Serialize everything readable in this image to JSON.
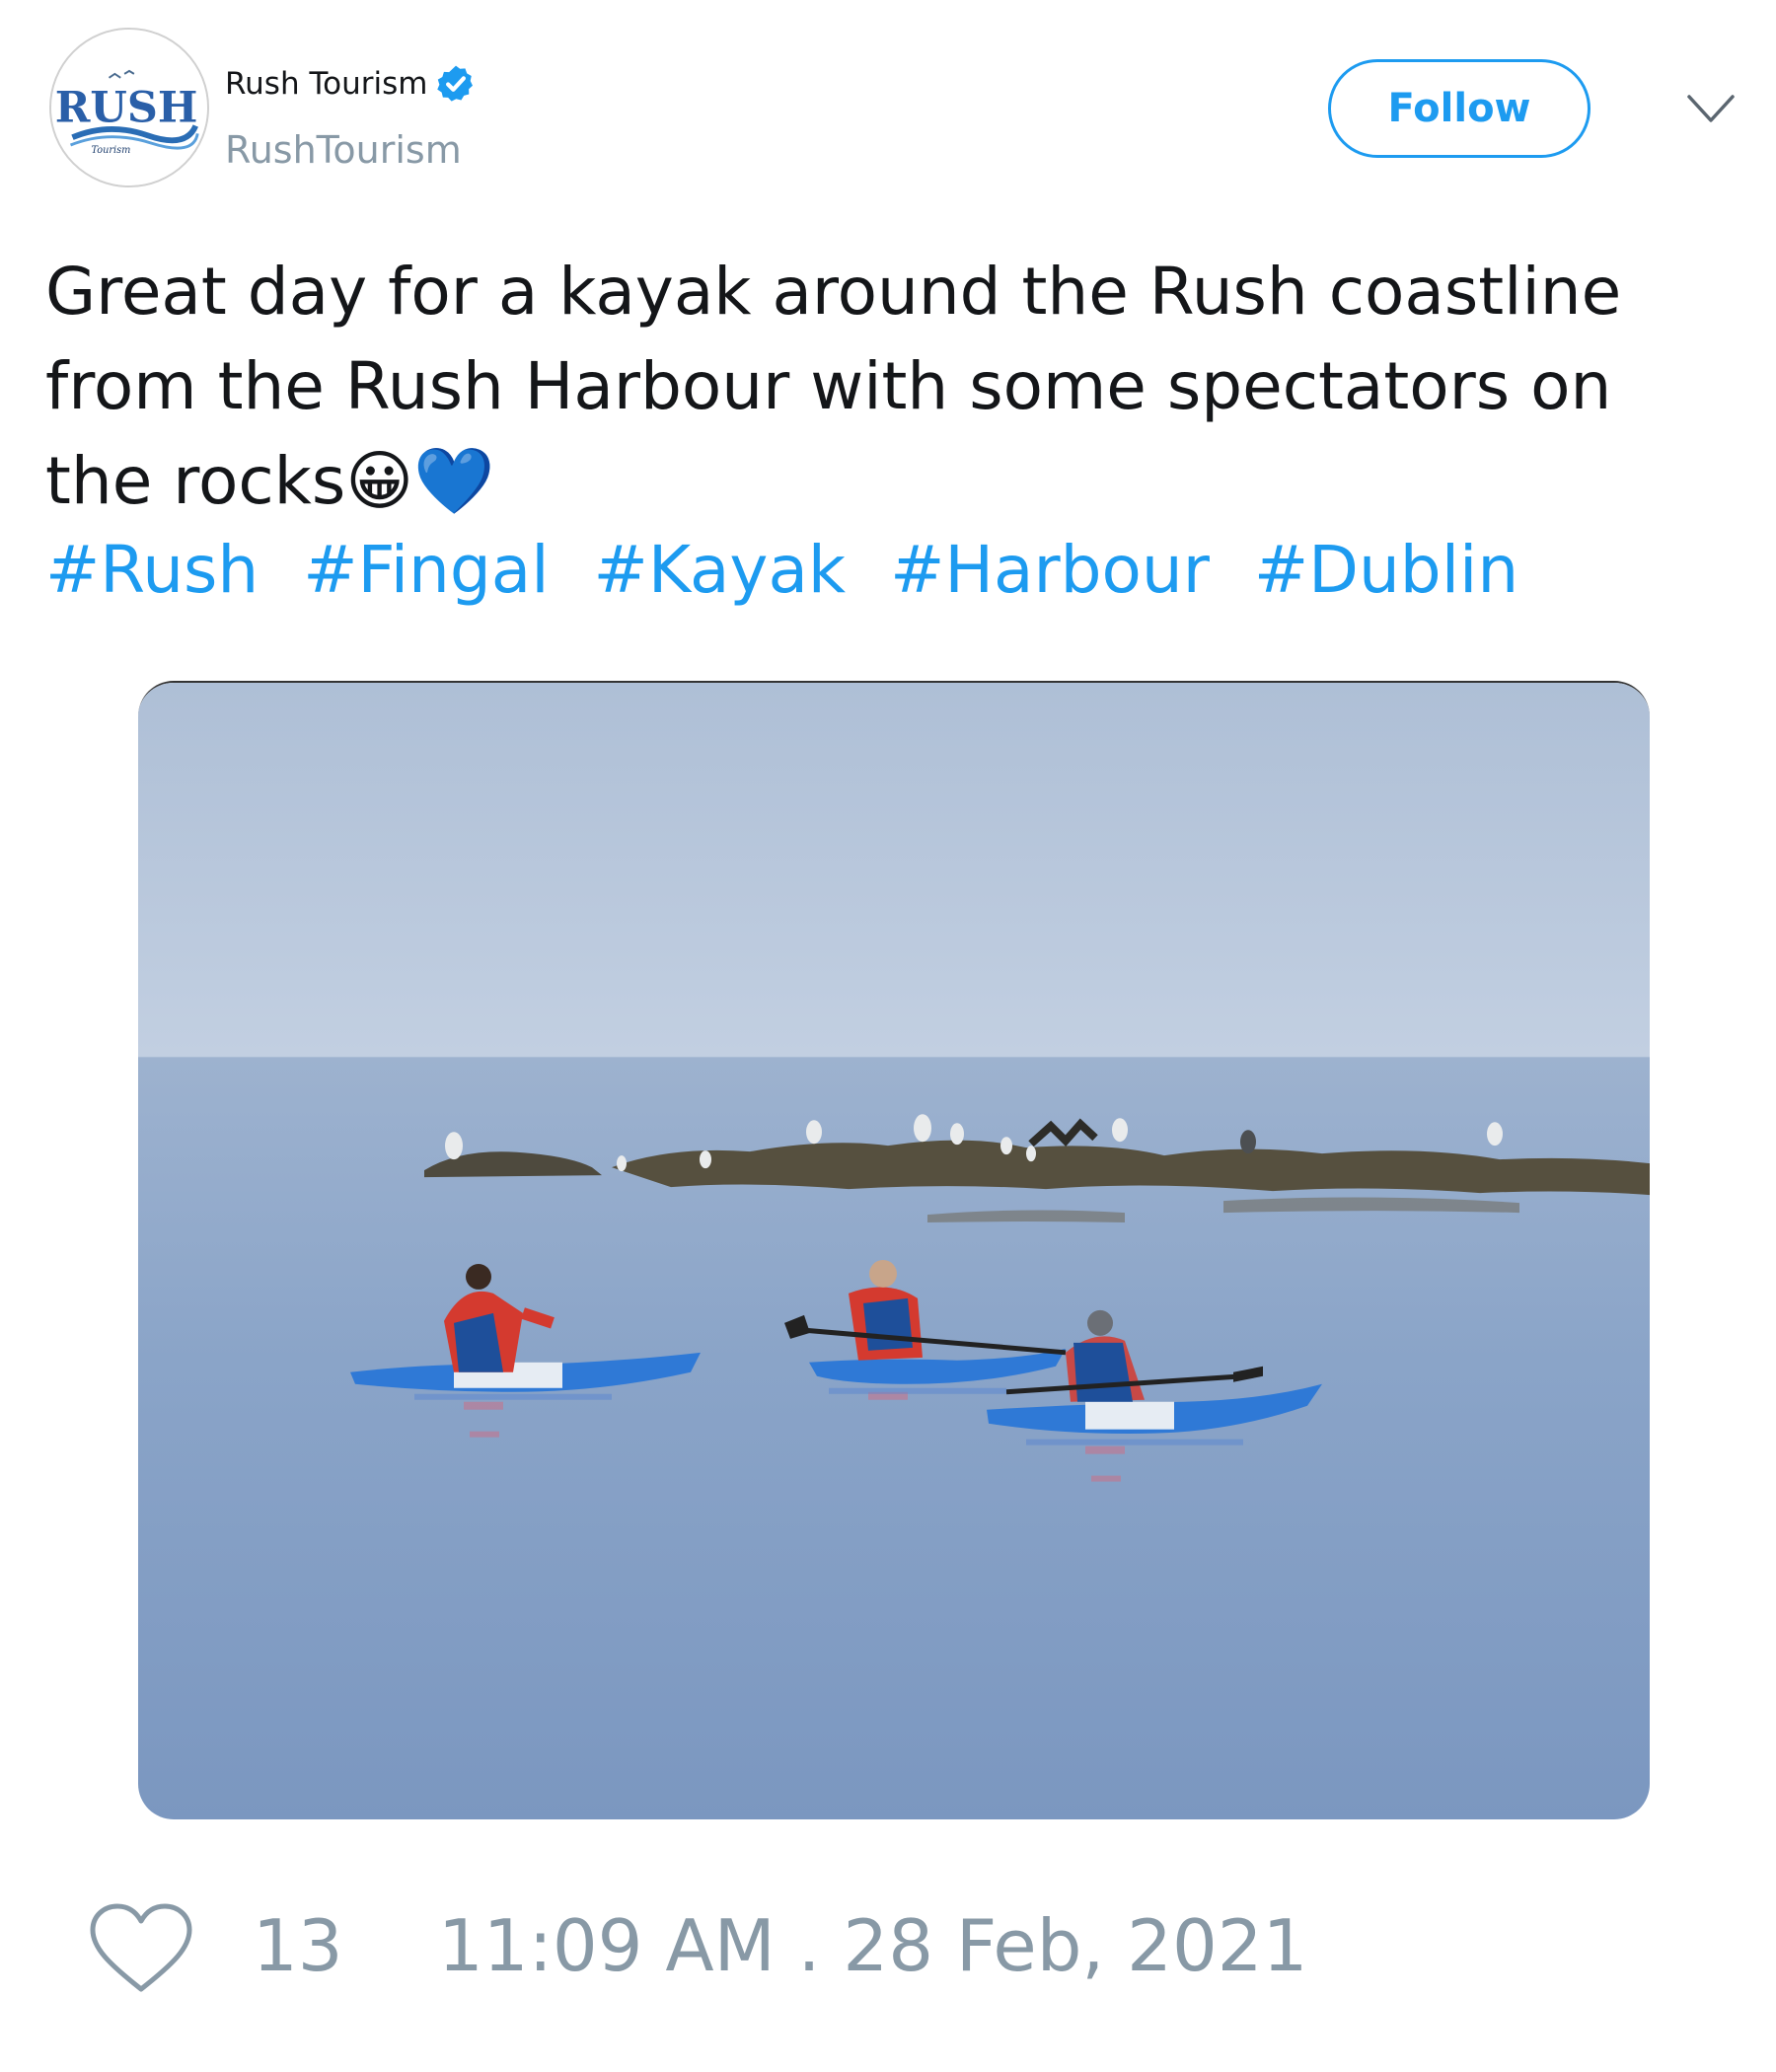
{
  "author": {
    "display_name": "Rush Tourism",
    "handle": "RushTourism",
    "avatar_logo_text": "RUSH",
    "avatar_logo_subtext": "Tourism",
    "verified_icon": "verified-badge-icon"
  },
  "actions": {
    "follow_label": "Follow",
    "menu_icon": "chevron-down-icon"
  },
  "tweet": {
    "text": "Great day for a kayak around the Rush coastline\nfrom the Rush Harbour with some spectators on\nthe rocks😀💙",
    "hashtags": [
      "#Rush",
      "#Fingal",
      "#Kayak",
      "#Harbour",
      "#Dublin"
    ],
    "photo_icon": "photo-kayakers-at-sea"
  },
  "footer": {
    "like_icon": "heart-icon",
    "like_count": "13",
    "timestamp": "11:09 AM . 28 Feb, 2021"
  },
  "colors": {
    "accent": "#1d9bf0",
    "muted": "#8899a6",
    "text": "#141619"
  }
}
